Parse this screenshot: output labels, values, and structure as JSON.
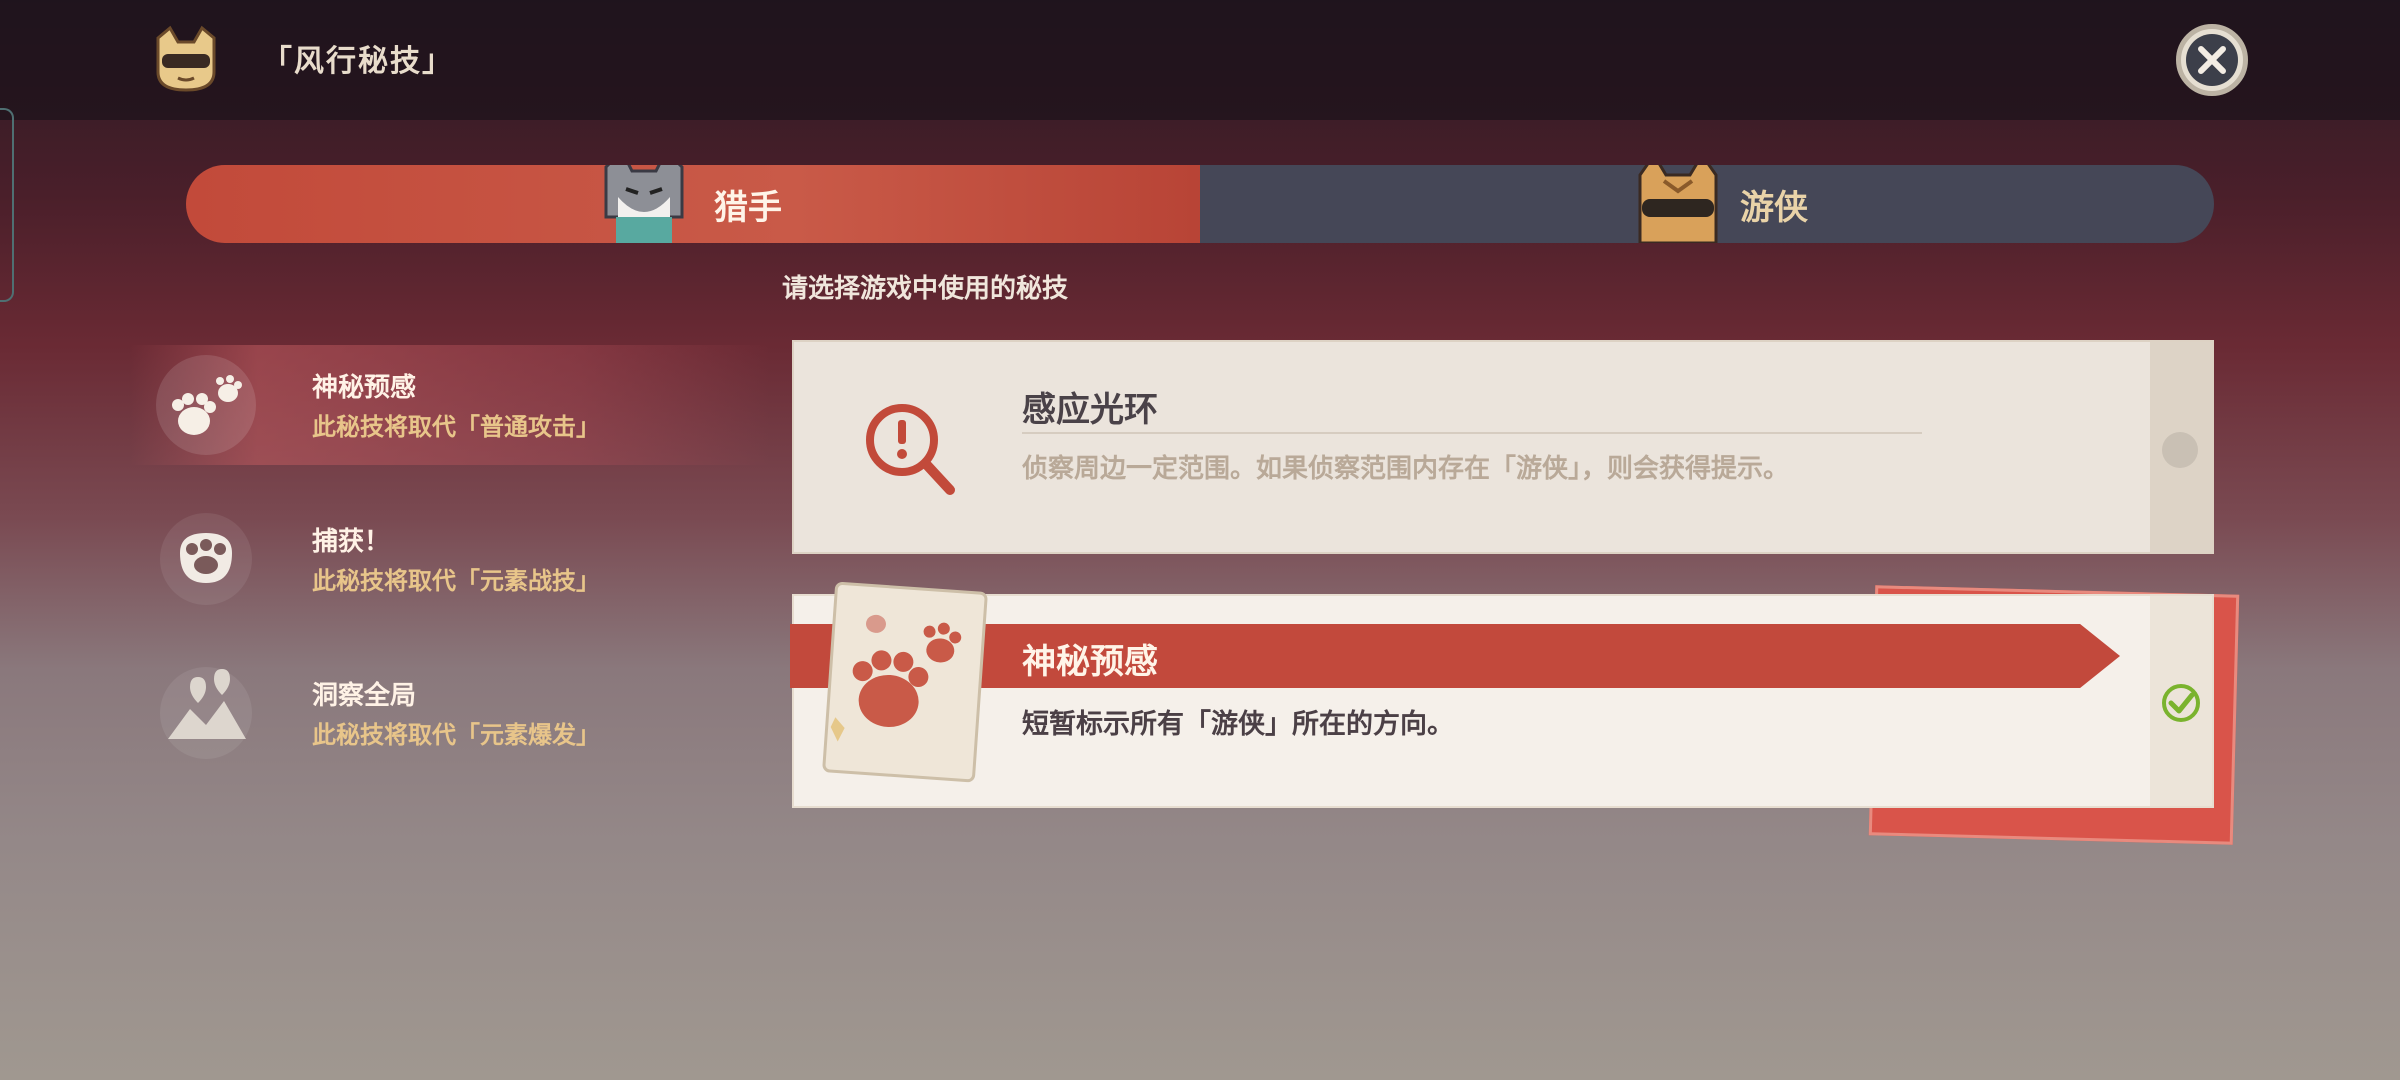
{
  "header": {
    "title": "「风行秘技」",
    "logo_icon": "cat-mask-icon",
    "close_icon": "close-icon"
  },
  "roles": [
    {
      "label": "猎手",
      "active": true,
      "avatar_icon": "grey-cat-avatar-icon"
    },
    {
      "label": "游侠",
      "active": false,
      "avatar_icon": "masked-cat-avatar-icon"
    }
  ],
  "prompt": "请选择游戏中使用的秘技",
  "skills": [
    {
      "name": "神秘预感",
      "desc": "此秘技将取代「普通攻击」",
      "icon": "paws-icon",
      "selected": true
    },
    {
      "name": "捕获！",
      "desc": "此秘技将取代「元素战技」",
      "icon": "cat-paw-icon",
      "selected": false
    },
    {
      "name": "洞察全局",
      "desc": "此秘技将取代「元素爆发」",
      "icon": "map-pins-icon",
      "selected": false
    }
  ],
  "options": [
    {
      "name": "感应光环",
      "desc": "侦察周边一定范围。如果侦察范围内存在「游侠」，则会获得提示。",
      "icon": "alert-magnifier-icon",
      "chosen": false
    },
    {
      "name": "神秘预感",
      "desc": "短暂标示所有「游侠」所在的方向。",
      "icon": "paws-card-icon",
      "chosen": true
    }
  ],
  "colors": {
    "accent_red": "#c24a3a",
    "inactive_tab": "#454757",
    "gold_text": "#e8c58a",
    "check_green": "#7ab32e"
  }
}
